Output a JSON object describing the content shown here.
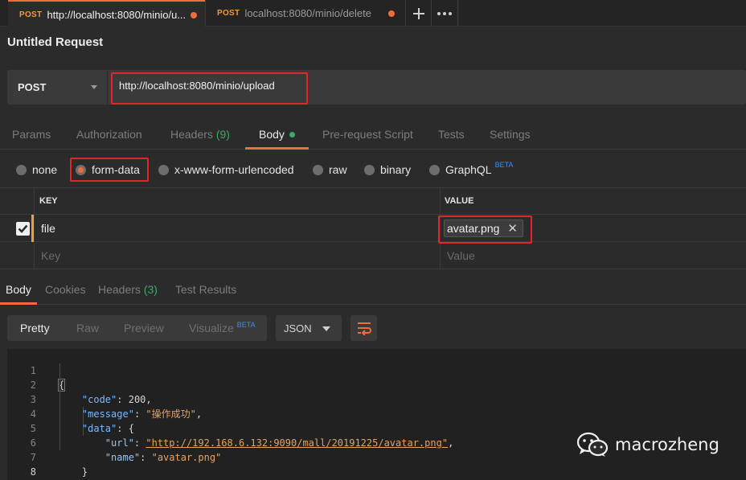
{
  "tabs": [
    {
      "method": "POST",
      "title": "http://localhost:8080/minio/u...",
      "active": true
    },
    {
      "method": "POST",
      "title": "localhost:8080/minio/delete",
      "active": false
    }
  ],
  "tab_actions": {
    "new_tab": "+",
    "more": "•••"
  },
  "request": {
    "title": "Untitled Request",
    "method": "POST",
    "url": "http://localhost:8080/minio/upload"
  },
  "request_tabs": {
    "params": "Params",
    "authorization": "Authorization",
    "headers": "Headers",
    "headers_count": "(9)",
    "body": "Body",
    "prerequest": "Pre-request Script",
    "tests": "Tests",
    "settings": "Settings"
  },
  "body_types": {
    "none": "none",
    "form_data": "form-data",
    "urlencoded": "x-www-form-urlencoded",
    "raw": "raw",
    "binary": "binary",
    "graphql": "GraphQL",
    "beta": "BETA",
    "selected": "form-data"
  },
  "form_table": {
    "key_header": "KEY",
    "value_header": "VALUE",
    "rows": [
      {
        "key": "file",
        "value": "avatar.png",
        "checked": true
      }
    ],
    "key_placeholder": "Key",
    "value_placeholder": "Value"
  },
  "response_tabs": {
    "body": "Body",
    "cookies": "Cookies",
    "headers": "Headers",
    "headers_count": "(3)",
    "test_results": "Test Results"
  },
  "response_view": {
    "pretty": "Pretty",
    "raw": "Raw",
    "preview": "Preview",
    "visualize": "Visualize",
    "beta": "BETA",
    "format": "JSON"
  },
  "code_lines": [
    {
      "n": "1",
      "t": "{"
    },
    {
      "n": "2",
      "t": "    \"code\": 200,"
    },
    {
      "n": "3",
      "t": "    \"message\": \"操作成功\","
    },
    {
      "n": "4",
      "t": "    \"data\": {"
    },
    {
      "n": "5",
      "t": "        \"url\": \"http://192.168.6.132:9090/mall/20191225/avatar.png\","
    },
    {
      "n": "6",
      "t": "        \"name\": \"avatar.png\""
    },
    {
      "n": "7",
      "t": "    }"
    },
    {
      "n": "8",
      "t": "}"
    }
  ],
  "response_json": {
    "code_key": "\"code\"",
    "code_val": "200",
    "message_key": "\"message\"",
    "message_val": "\"操作成功\"",
    "data_key": "\"data\"",
    "url_key": "\"url\"",
    "url_val": "\"http://192.168.6.132:9090/mall/20191225/avatar.png\"",
    "name_key": "\"name\"",
    "name_val": "\"avatar.png\""
  },
  "watermark": "macrozheng",
  "colors": {
    "accent": "#f26b3a",
    "highlight_box": "#e0272b",
    "count_green": "#3fa86b",
    "beta_blue": "#3d8fea"
  }
}
